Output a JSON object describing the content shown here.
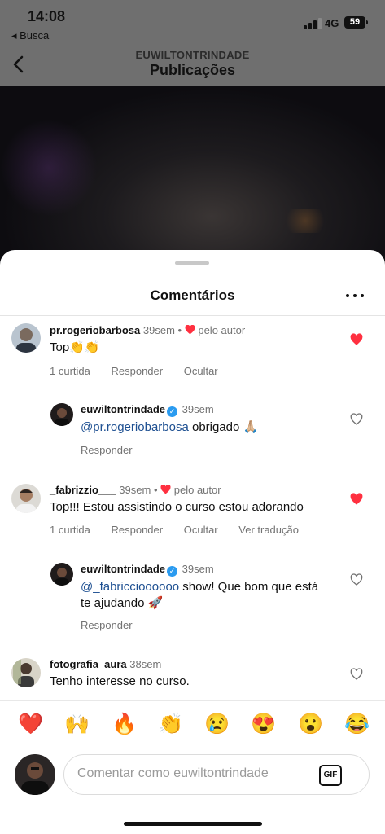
{
  "status_bar": {
    "time": "14:08",
    "back_app": "◂ Busca",
    "network": "4G",
    "battery": "59"
  },
  "header": {
    "username": "EUWILTONTRINDADE",
    "title": "Publicações"
  },
  "sheet": {
    "title": "Comentários"
  },
  "comments": [
    {
      "username": "pr.rogeriobarbosa",
      "time": "39sem",
      "by_author": "pelo autor",
      "text": "Top👏👏",
      "likes": "1 curtida",
      "reply": "Responder",
      "hide": "Ocultar",
      "liked": true
    },
    {
      "username": "euwiltontrindade",
      "time": "39sem",
      "mention": "@pr.rogeriobarbosa",
      "text": " obrigado 🙏🏼",
      "reply": "Responder",
      "liked": false
    },
    {
      "username": "_fabrizzio___",
      "time": "39sem",
      "by_author": "pelo autor",
      "text": "Top!!! Estou assistindo o curso estou adorando",
      "likes": "1 curtida",
      "reply": "Responder",
      "hide": "Ocultar",
      "translate": "Ver tradução",
      "liked": true
    },
    {
      "username": "euwiltontrindade",
      "time": "39sem",
      "mention": "@_fabriccioooooo",
      "text": " show! Que bom que está te ajudando 🚀",
      "reply": "Responder",
      "liked": false
    },
    {
      "username": "fotografia_aura",
      "time": "38sem",
      "text": "Tenho interesse no curso.",
      "liked": false
    }
  ],
  "reactions": [
    "❤️",
    "🙌",
    "🔥",
    "👏",
    "😢",
    "😍",
    "😮",
    "😂"
  ],
  "composer": {
    "placeholder": "Comentar como euwiltontrindade",
    "gif_label": "GIF"
  },
  "colors": {
    "heart": "#ff3040",
    "mention": "#1d4f91",
    "verified": "#2a9bf0"
  }
}
